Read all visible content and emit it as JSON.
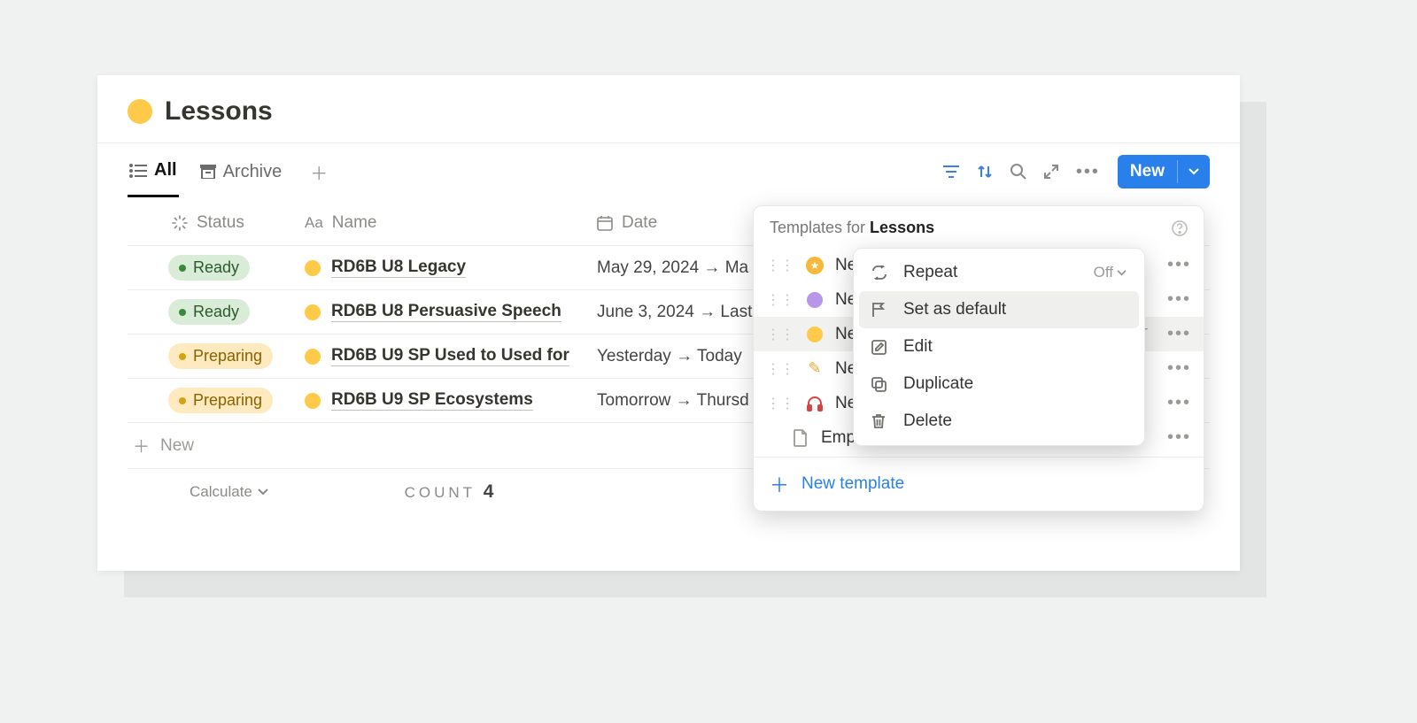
{
  "page": {
    "title": "Lessons"
  },
  "tabs": {
    "all": "All",
    "archive": "Archive"
  },
  "toolbar": {
    "new_label": "New"
  },
  "columns": {
    "status": "Status",
    "name": "Name",
    "date": "Date"
  },
  "rows": [
    {
      "status_kind": "ready",
      "status": "Ready",
      "name": "RD6B U8 Legacy",
      "date": "May 29, 2024 → Ma"
    },
    {
      "status_kind": "ready",
      "status": "Ready",
      "name": "RD6B U8 Persuasive Speech",
      "date": "June 3, 2024 → Last"
    },
    {
      "status_kind": "preparing",
      "status": "Preparing",
      "name": "RD6B U9 SP Used to Used for",
      "date": "Yesterday → Today"
    },
    {
      "status_kind": "preparing",
      "status": "Preparing",
      "name": "RD6B U9 SP Ecosystems",
      "date": "Tomorrow → Thursd"
    }
  ],
  "new_row_label": "New",
  "footer": {
    "calculate": "Calculate",
    "count_label": "COUNT",
    "count_value": "4"
  },
  "templates_popup": {
    "title_prefix": "Templates for ",
    "title_bold": "Lessons",
    "items": [
      {
        "icon": "star",
        "label": "Ne",
        "badge": ""
      },
      {
        "icon": "purple",
        "label": "Ne",
        "badge": ""
      },
      {
        "icon": "yellow",
        "label": "Ne",
        "badge": "T"
      },
      {
        "icon": "pencil",
        "label": "Ne",
        "badge": ""
      },
      {
        "icon": "head",
        "label": "Ne",
        "badge": ""
      },
      {
        "icon": "file",
        "label": "Empty",
        "badge": ""
      }
    ],
    "new_template": "New template"
  },
  "context_menu": {
    "repeat": {
      "label": "Repeat",
      "tail": "Off"
    },
    "default": {
      "label": "Set as default"
    },
    "edit": {
      "label": "Edit"
    },
    "duplicate": {
      "label": "Duplicate"
    },
    "delete": {
      "label": "Delete"
    }
  }
}
